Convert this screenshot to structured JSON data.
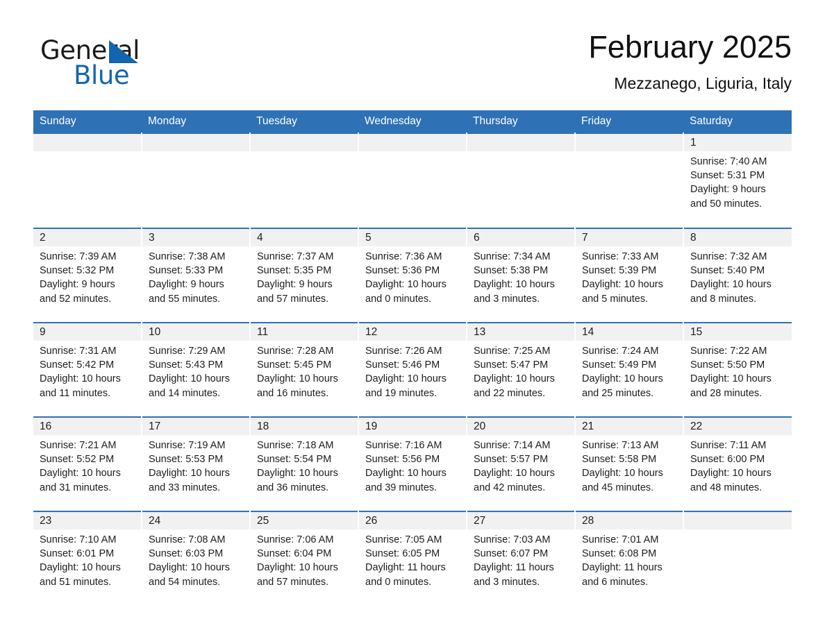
{
  "brand": {
    "name_part1": "General",
    "name_part2": "Blue",
    "triangle_color": "#1266b0",
    "text_color": "#1b1b1b"
  },
  "header": {
    "month_title": "February 2025",
    "location": "Mezzanego, Liguria, Italy"
  },
  "theme": {
    "header_blue": "#2e71b5",
    "daynum_band": "#f1f1f1",
    "page_background": "#ffffff",
    "text": "#1d1d1d"
  },
  "weekday_headers": [
    "Sunday",
    "Monday",
    "Tuesday",
    "Wednesday",
    "Thursday",
    "Friday",
    "Saturday"
  ],
  "weeks": [
    [
      {
        "day": "",
        "sunrise": "",
        "sunset": "",
        "daylight_line1": "",
        "daylight_line2": ""
      },
      {
        "day": "",
        "sunrise": "",
        "sunset": "",
        "daylight_line1": "",
        "daylight_line2": ""
      },
      {
        "day": "",
        "sunrise": "",
        "sunset": "",
        "daylight_line1": "",
        "daylight_line2": ""
      },
      {
        "day": "",
        "sunrise": "",
        "sunset": "",
        "daylight_line1": "",
        "daylight_line2": ""
      },
      {
        "day": "",
        "sunrise": "",
        "sunset": "",
        "daylight_line1": "",
        "daylight_line2": ""
      },
      {
        "day": "",
        "sunrise": "",
        "sunset": "",
        "daylight_line1": "",
        "daylight_line2": ""
      },
      {
        "day": "1",
        "sunrise": "Sunrise: 7:40 AM",
        "sunset": "Sunset: 5:31 PM",
        "daylight_line1": "Daylight: 9 hours",
        "daylight_line2": "and 50 minutes."
      }
    ],
    [
      {
        "day": "2",
        "sunrise": "Sunrise: 7:39 AM",
        "sunset": "Sunset: 5:32 PM",
        "daylight_line1": "Daylight: 9 hours",
        "daylight_line2": "and 52 minutes."
      },
      {
        "day": "3",
        "sunrise": "Sunrise: 7:38 AM",
        "sunset": "Sunset: 5:33 PM",
        "daylight_line1": "Daylight: 9 hours",
        "daylight_line2": "and 55 minutes."
      },
      {
        "day": "4",
        "sunrise": "Sunrise: 7:37 AM",
        "sunset": "Sunset: 5:35 PM",
        "daylight_line1": "Daylight: 9 hours",
        "daylight_line2": "and 57 minutes."
      },
      {
        "day": "5",
        "sunrise": "Sunrise: 7:36 AM",
        "sunset": "Sunset: 5:36 PM",
        "daylight_line1": "Daylight: 10 hours",
        "daylight_line2": "and 0 minutes."
      },
      {
        "day": "6",
        "sunrise": "Sunrise: 7:34 AM",
        "sunset": "Sunset: 5:38 PM",
        "daylight_line1": "Daylight: 10 hours",
        "daylight_line2": "and 3 minutes."
      },
      {
        "day": "7",
        "sunrise": "Sunrise: 7:33 AM",
        "sunset": "Sunset: 5:39 PM",
        "daylight_line1": "Daylight: 10 hours",
        "daylight_line2": "and 5 minutes."
      },
      {
        "day": "8",
        "sunrise": "Sunrise: 7:32 AM",
        "sunset": "Sunset: 5:40 PM",
        "daylight_line1": "Daylight: 10 hours",
        "daylight_line2": "and 8 minutes."
      }
    ],
    [
      {
        "day": "9",
        "sunrise": "Sunrise: 7:31 AM",
        "sunset": "Sunset: 5:42 PM",
        "daylight_line1": "Daylight: 10 hours",
        "daylight_line2": "and 11 minutes."
      },
      {
        "day": "10",
        "sunrise": "Sunrise: 7:29 AM",
        "sunset": "Sunset: 5:43 PM",
        "daylight_line1": "Daylight: 10 hours",
        "daylight_line2": "and 14 minutes."
      },
      {
        "day": "11",
        "sunrise": "Sunrise: 7:28 AM",
        "sunset": "Sunset: 5:45 PM",
        "daylight_line1": "Daylight: 10 hours",
        "daylight_line2": "and 16 minutes."
      },
      {
        "day": "12",
        "sunrise": "Sunrise: 7:26 AM",
        "sunset": "Sunset: 5:46 PM",
        "daylight_line1": "Daylight: 10 hours",
        "daylight_line2": "and 19 minutes."
      },
      {
        "day": "13",
        "sunrise": "Sunrise: 7:25 AM",
        "sunset": "Sunset: 5:47 PM",
        "daylight_line1": "Daylight: 10 hours",
        "daylight_line2": "and 22 minutes."
      },
      {
        "day": "14",
        "sunrise": "Sunrise: 7:24 AM",
        "sunset": "Sunset: 5:49 PM",
        "daylight_line1": "Daylight: 10 hours",
        "daylight_line2": "and 25 minutes."
      },
      {
        "day": "15",
        "sunrise": "Sunrise: 7:22 AM",
        "sunset": "Sunset: 5:50 PM",
        "daylight_line1": "Daylight: 10 hours",
        "daylight_line2": "and 28 minutes."
      }
    ],
    [
      {
        "day": "16",
        "sunrise": "Sunrise: 7:21 AM",
        "sunset": "Sunset: 5:52 PM",
        "daylight_line1": "Daylight: 10 hours",
        "daylight_line2": "and 31 minutes."
      },
      {
        "day": "17",
        "sunrise": "Sunrise: 7:19 AM",
        "sunset": "Sunset: 5:53 PM",
        "daylight_line1": "Daylight: 10 hours",
        "daylight_line2": "and 33 minutes."
      },
      {
        "day": "18",
        "sunrise": "Sunrise: 7:18 AM",
        "sunset": "Sunset: 5:54 PM",
        "daylight_line1": "Daylight: 10 hours",
        "daylight_line2": "and 36 minutes."
      },
      {
        "day": "19",
        "sunrise": "Sunrise: 7:16 AM",
        "sunset": "Sunset: 5:56 PM",
        "daylight_line1": "Daylight: 10 hours",
        "daylight_line2": "and 39 minutes."
      },
      {
        "day": "20",
        "sunrise": "Sunrise: 7:14 AM",
        "sunset": "Sunset: 5:57 PM",
        "daylight_line1": "Daylight: 10 hours",
        "daylight_line2": "and 42 minutes."
      },
      {
        "day": "21",
        "sunrise": "Sunrise: 7:13 AM",
        "sunset": "Sunset: 5:58 PM",
        "daylight_line1": "Daylight: 10 hours",
        "daylight_line2": "and 45 minutes."
      },
      {
        "day": "22",
        "sunrise": "Sunrise: 7:11 AM",
        "sunset": "Sunset: 6:00 PM",
        "daylight_line1": "Daylight: 10 hours",
        "daylight_line2": "and 48 minutes."
      }
    ],
    [
      {
        "day": "23",
        "sunrise": "Sunrise: 7:10 AM",
        "sunset": "Sunset: 6:01 PM",
        "daylight_line1": "Daylight: 10 hours",
        "daylight_line2": "and 51 minutes."
      },
      {
        "day": "24",
        "sunrise": "Sunrise: 7:08 AM",
        "sunset": "Sunset: 6:03 PM",
        "daylight_line1": "Daylight: 10 hours",
        "daylight_line2": "and 54 minutes."
      },
      {
        "day": "25",
        "sunrise": "Sunrise: 7:06 AM",
        "sunset": "Sunset: 6:04 PM",
        "daylight_line1": "Daylight: 10 hours",
        "daylight_line2": "and 57 minutes."
      },
      {
        "day": "26",
        "sunrise": "Sunrise: 7:05 AM",
        "sunset": "Sunset: 6:05 PM",
        "daylight_line1": "Daylight: 11 hours",
        "daylight_line2": "and 0 minutes."
      },
      {
        "day": "27",
        "sunrise": "Sunrise: 7:03 AM",
        "sunset": "Sunset: 6:07 PM",
        "daylight_line1": "Daylight: 11 hours",
        "daylight_line2": "and 3 minutes."
      },
      {
        "day": "28",
        "sunrise": "Sunrise: 7:01 AM",
        "sunset": "Sunset: 6:08 PM",
        "daylight_line1": "Daylight: 11 hours",
        "daylight_line2": "and 6 minutes."
      },
      {
        "day": "",
        "sunrise": "",
        "sunset": "",
        "daylight_line1": "",
        "daylight_line2": ""
      }
    ]
  ]
}
